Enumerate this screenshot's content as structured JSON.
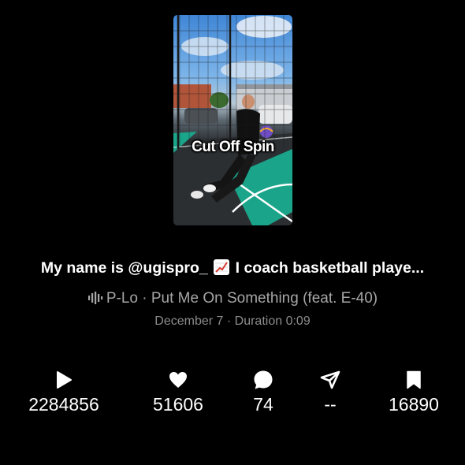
{
  "video": {
    "overlay_text": "Cut Off Spin"
  },
  "caption": {
    "before": "My name is @ugispro_ ",
    "after": " I coach basketball playe..."
  },
  "music": {
    "text": "P-Lo · Put Me On Something (feat. E-40)"
  },
  "meta": {
    "text": "December 7 · Duration 0:09"
  },
  "stats": {
    "plays": "2284856",
    "likes": "51606",
    "comments": "74",
    "shares": "--",
    "saves": "16890"
  },
  "icons": {
    "plays": "play-icon",
    "likes": "heart-icon",
    "comments": "comment-bubble-icon",
    "shares": "send-arrow-icon",
    "saves": "bookmark-icon",
    "music": "sound-wave-icon",
    "caption_emoji": "chart-increasing-emoji-icon"
  },
  "colors": {
    "background": "#000000",
    "primary_text": "#ffffff",
    "secondary_text": "#a6a6a6",
    "court_teal": "#1aa58a"
  }
}
